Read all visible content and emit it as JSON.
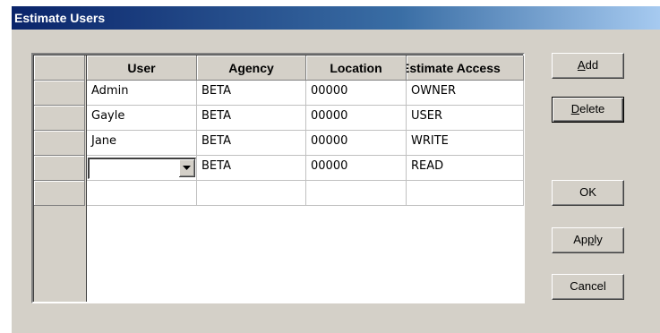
{
  "window": {
    "title": "Estimate Users"
  },
  "table": {
    "columns": [
      "User",
      "Agency",
      "Location",
      "Estimate Access"
    ],
    "rows": [
      {
        "user": "Admin",
        "agency": "BETA",
        "location": "00000",
        "access": "OWNER"
      },
      {
        "user": "Gayle",
        "agency": "BETA",
        "location": "00000",
        "access": "USER"
      },
      {
        "user": "Jane",
        "agency": "BETA",
        "location": "00000",
        "access": "WRITE"
      },
      {
        "user": "",
        "agency": "BETA",
        "location": "00000",
        "access": "READ"
      },
      {
        "user": "",
        "agency": "",
        "location": "",
        "access": ""
      }
    ]
  },
  "buttons": {
    "add": {
      "pre": "",
      "key": "A",
      "post": "dd"
    },
    "delete": {
      "pre": "",
      "key": "D",
      "post": "elete"
    },
    "ok": {
      "label": "OK"
    },
    "apply": {
      "pre": "Ap",
      "key": "p",
      "post": "ly"
    },
    "cancel": {
      "label": "Cancel"
    }
  },
  "icons": {
    "dropdown": "chevron-down-icon"
  },
  "colors": {
    "title_start": "#0a246a",
    "title_end": "#a6caf0",
    "face": "#d4d0c8"
  }
}
